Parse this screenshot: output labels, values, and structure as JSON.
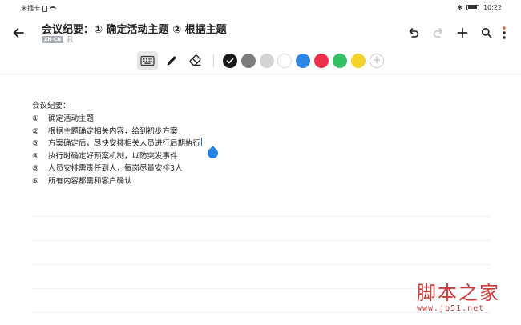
{
  "status_bar": {
    "carrier": "未插卡",
    "time": "10:22",
    "icons": [
      "sim-icon",
      "wifi-icon",
      "bluetooth-icon",
      "battery-icon"
    ]
  },
  "header": {
    "title": "会议纪要：① 确定活动主题 ② 根据主题",
    "lang_badge": "ZH-CN",
    "author": "我",
    "actions": [
      "back-arrow-icon",
      "undo-icon",
      "redo-icon",
      "add-icon",
      "search-icon",
      "more-icon"
    ]
  },
  "toolbar": {
    "tools": [
      "keyboard-icon",
      "pen-icon",
      "eraser-icon"
    ],
    "active_tool": "keyboard",
    "selected_color": "#1a1a1a",
    "colors": [
      "#1a1a1a",
      "#7d7d7d",
      "#d4d4d4",
      "#ffffff",
      "#2d86e8",
      "#ee2f4a",
      "#33c163",
      "#f4d22c"
    ]
  },
  "note": {
    "heading": "会议纪要：",
    "items": [
      {
        "num": "①",
        "text": "确定活动主题"
      },
      {
        "num": "②",
        "text": "根据主题确定相关内容，给到初步方案"
      },
      {
        "num": "③",
        "text": "方案确定后，尽快安排相关人员进行后期执行"
      },
      {
        "num": "④",
        "text": "执行时确定好预案机制，以防突发事件"
      },
      {
        "num": "⑤",
        "text": "人员安排需责任到人，每岗尽量安排3人"
      },
      {
        "num": "⑥",
        "text": "所有内容都需和客户确认"
      }
    ]
  },
  "watermark": {
    "title": "脚本之家",
    "url": "www.jb51.net"
  }
}
